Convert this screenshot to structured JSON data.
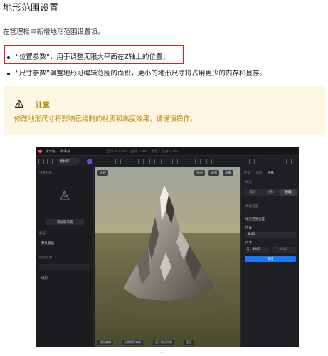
{
  "doc": {
    "title": "地形范围设置",
    "intro": "在管理栏中新增地形范围设置项。",
    "bullets": [
      "“位置参数”，用于调整无限大平面在Z轴上的位置；",
      "“尺寸参数”调整地形可编辑范围的面积，更小的地形尺寸将占用更少的内存和显存。"
    ],
    "note": {
      "icon": "warning-icon",
      "title": "注意",
      "text": "修改地形尺寸将影响已绘制的材质和高度效果，请谨慎操作。"
    },
    "caption": "⋯"
  },
  "app": {
    "window_title": "未命名 - 未保存",
    "titlebar_center": "显示 60 FPS · 面数 0.4M · 场景 · 显存 0.6G",
    "project_pill": "素材库",
    "left": {
      "section_scene": "场景列表",
      "import_button": "添加新场景",
      "section_layers": "图层",
      "layer_item": "默认图层",
      "section_assets": "场景资源",
      "assets_action": "导入",
      "asset_item": "地形"
    },
    "viewport": {
      "top_left": "透视",
      "top_right": [
        "视图",
        "光照",
        "设置"
      ],
      "bottom": [
        "地形编辑",
        "启用地形笔刷",
        "显示地形网格",
        "更多"
      ]
    },
    "right": {
      "tabs": [
        "环境",
        "后期",
        "地形"
      ],
      "active_tab": "地形",
      "section": "地形",
      "segments": [
        "笔刷",
        "绘制",
        "管理"
      ],
      "active_segment": "管理",
      "collapsed_row": "高级设置",
      "group_title": "地形范围设置",
      "position_label": "位置",
      "position_value": "-0.03",
      "size_label": "尺寸",
      "size_x_label": "X",
      "size_x_value": "4000",
      "size_y_label": "Y",
      "size_y_value": "4000",
      "apply_button": "确定"
    }
  },
  "colors": {
    "note_bg": "#fdf6e3",
    "note_accent": "#c1840c",
    "highlight": "#e02020",
    "primary": "#1677ff"
  }
}
